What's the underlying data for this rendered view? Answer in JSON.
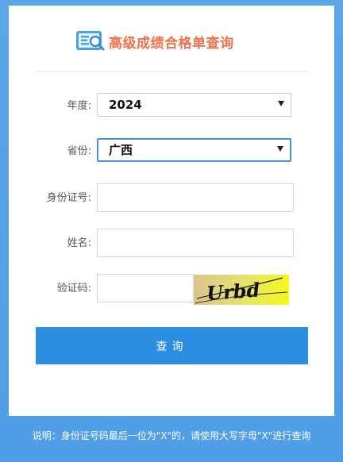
{
  "header": {
    "title": "高级成绩合格单查询",
    "logo_icon": "search-doc-icon"
  },
  "form": {
    "year_label": "年度:",
    "year_value": "2024",
    "province_label": "省份:",
    "province_value": "广西",
    "id_label": "身份证号:",
    "id_value": "",
    "name_label": "姓名:",
    "name_value": "",
    "captcha_label": "验证码:",
    "captcha_value": "",
    "captcha_text": "Urbd"
  },
  "submit_label": "查询",
  "footer_note": "说明：身份证号码最后一位为\"X\"的，请使用大写字母\"X\"进行查询",
  "colors": {
    "accent": "#2b8ee0",
    "title": "#f0704a",
    "background": "#5aa6e8"
  }
}
